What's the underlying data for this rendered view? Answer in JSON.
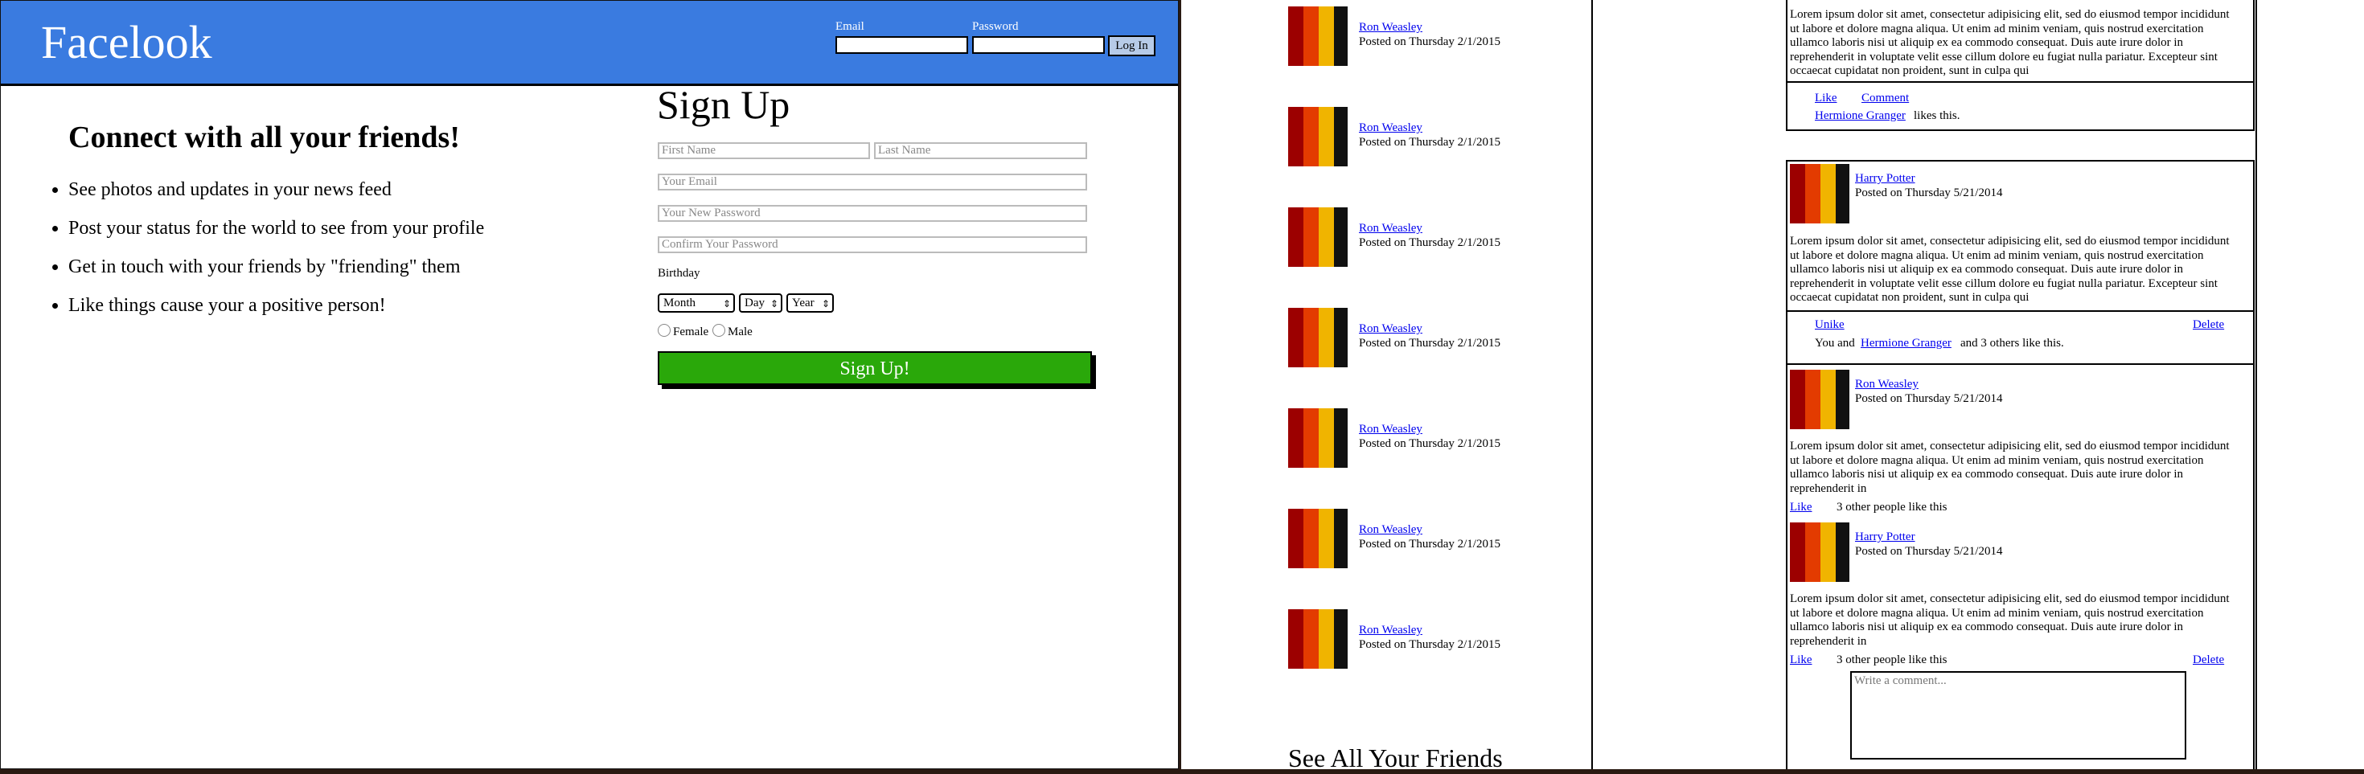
{
  "signup_page": {
    "logo": "Facelook",
    "login": {
      "email_label": "Email",
      "password_label": "Password",
      "button": "Log In"
    },
    "tagline": "Connect with all your friends!",
    "features": [
      "See photos and updates in your news feed",
      "Post your status for the world to see from your profile",
      "Get in touch with your friends by \"friending\" them",
      "Like things cause your a positive person!"
    ],
    "signup": {
      "title": "Sign Up",
      "first_name": "First Name",
      "last_name": "Last Name",
      "email": "Your Email",
      "password": "Your New Password",
      "confirm": "Confirm Your Password",
      "birthday_label": "Birthday",
      "month": "Month",
      "day": "Day",
      "year": "Year",
      "female": "Female",
      "male": "Male",
      "button": "Sign Up!"
    }
  },
  "friends_column": {
    "friends": [
      {
        "name": "Ron Weasley",
        "posted": "Posted on Thursday 2/1/2015"
      },
      {
        "name": "Ron Weasley",
        "posted": "Posted on Thursday 2/1/2015"
      },
      {
        "name": "Ron Weasley",
        "posted": "Posted on Thursday 2/1/2015"
      },
      {
        "name": "Ron Weasley",
        "posted": "Posted on Thursday 2/1/2015"
      },
      {
        "name": "Ron Weasley",
        "posted": "Posted on Thursday 2/1/2015"
      },
      {
        "name": "Ron Weasley",
        "posted": "Posted on Thursday 2/1/2015"
      },
      {
        "name": "Ron Weasley",
        "posted": "Posted on Thursday 2/1/2015"
      }
    ],
    "see_all": "See All Your Friends"
  },
  "feed": {
    "lorem_long": "Lorem ipsum dolor sit amet, consectetur adipisicing elit, sed do eiusmod tempor incididunt ut labore et dolore magna aliqua. Ut enim ad minim veniam, quis nostrud exercitation ullamco laboris nisi ut aliquip ex ea commodo consequat. Duis aute irure dolor in reprehenderit in voluptate velit esse cillum dolore eu fugiat nulla pariatur. Excepteur sint occaecat cupidatat non proident, sunt in culpa qui",
    "lorem_short": "Lorem ipsum dolor sit amet, consectetur adipisicing elit, sed do eiusmod tempor incididunt ut labore et dolore magna aliqua. Ut enim ad minim veniam, quis nostrud exercitation ullamco laboris nisi ut aliquip ex ea commodo consequat. Duis aute irure dolor in reprehenderit in",
    "top_post": {
      "like": "Like",
      "comment": "Comment",
      "liker": "Hermione Granger",
      "likes_suffix": "likes this."
    },
    "post2": {
      "author": "Harry Potter",
      "posted": "Posted on Thursday 5/21/2014",
      "unlike": "Unike",
      "delete": "Delete",
      "you_and": "You and",
      "liker": "Hermione Granger",
      "others": "and 3 others like this."
    },
    "comment1": {
      "author": "Ron Weasley",
      "posted": "Posted on Thursday 5/21/2014",
      "like": "Like",
      "count": "3 other people like this"
    },
    "comment2": {
      "author": "Harry Potter",
      "posted": "Posted on Thursday 5/21/2014",
      "like": "Like",
      "count": "3 other people like this",
      "delete": "Delete"
    },
    "comment_placeholder": "Write a comment..."
  },
  "colors": {
    "header_blue": "#3a7be0",
    "signup_green": "#2aa80a",
    "link_blue": "#0000ee"
  }
}
